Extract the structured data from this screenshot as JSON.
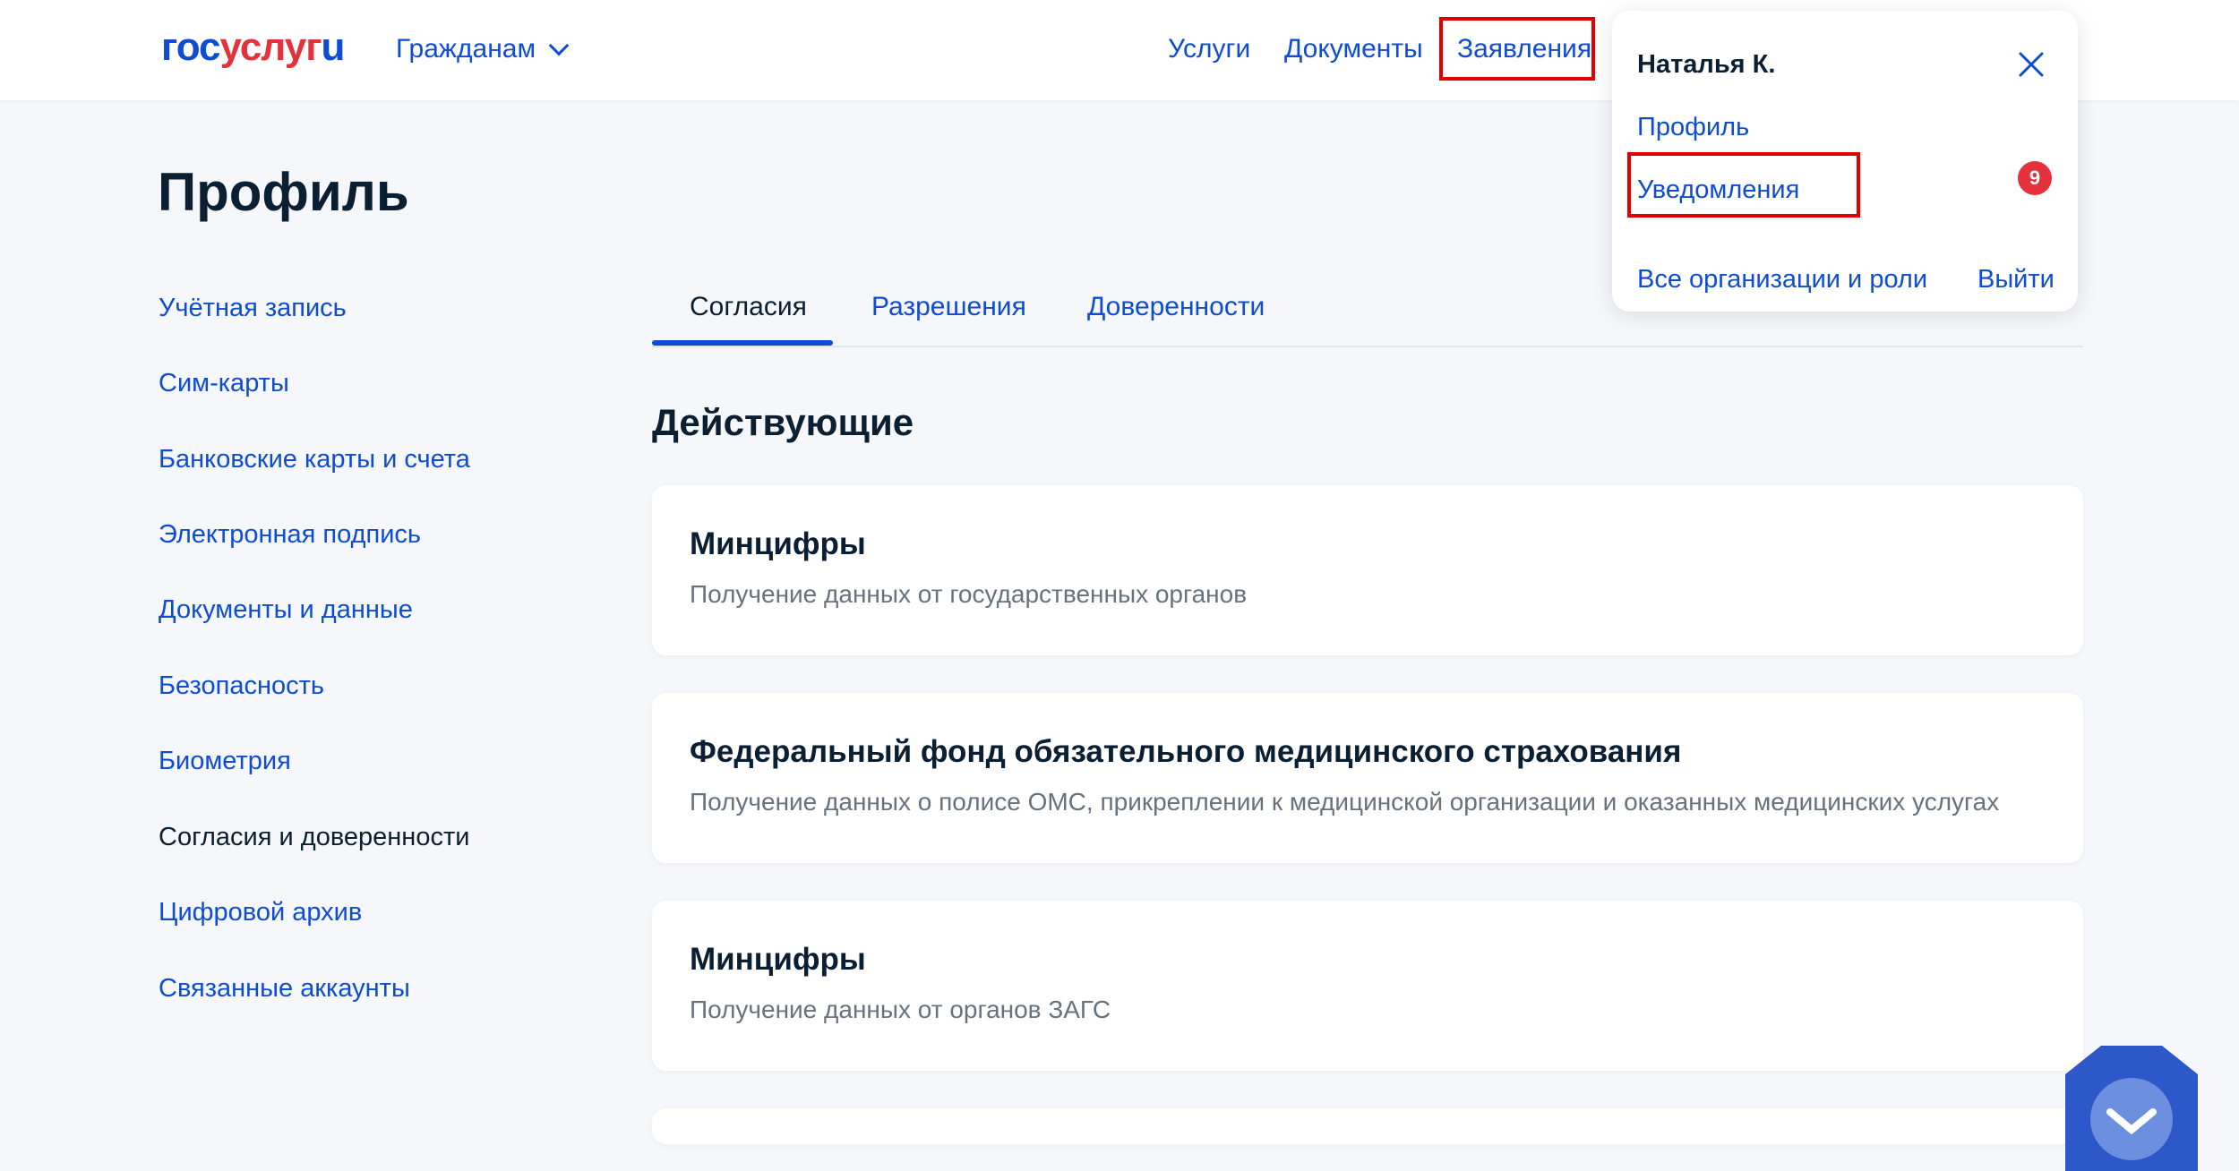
{
  "header": {
    "logo": {
      "part1": "гос",
      "part2": "услуг",
      "part3": "u"
    },
    "audience": "Гражданам",
    "nav": [
      "Услуги",
      "Документы",
      "Заявления"
    ]
  },
  "page": {
    "title": "Профиль"
  },
  "sidebar": {
    "items": [
      {
        "label": "Учётная запись"
      },
      {
        "label": "Сим-карты"
      },
      {
        "label": "Банковские карты и счета"
      },
      {
        "label": "Электронная подпись"
      },
      {
        "label": "Документы и данные"
      },
      {
        "label": "Безопасность"
      },
      {
        "label": "Биометрия"
      },
      {
        "label": "Согласия и доверенности"
      },
      {
        "label": "Цифровой архив"
      },
      {
        "label": "Связанные аккаунты"
      }
    ]
  },
  "tabs": [
    {
      "label": "Согласия"
    },
    {
      "label": "Разрешения"
    },
    {
      "label": "Доверенности"
    }
  ],
  "section": {
    "title": "Действующие"
  },
  "cards": [
    {
      "title": "Минцифры",
      "desc": "Получение данных от государственных органов"
    },
    {
      "title": "Федеральный фонд обязательного медицинского страхования",
      "desc": "Получение данных о полисе ОМС, прикреплении к медицинской организации и оказанных медицинских услугах"
    },
    {
      "title": "Минцифры",
      "desc": "Получение данных от органов ЗАГС"
    }
  ],
  "user_menu": {
    "name": "Наталья К.",
    "profile": "Профиль",
    "notifications": "Уведомления",
    "notifications_count": "9",
    "orgs": "Все организации и роли",
    "logout": "Выйти"
  },
  "colors": {
    "brand_blue": "#0d4cd3",
    "brand_red": "#e3323b",
    "highlight": "#e00000"
  }
}
